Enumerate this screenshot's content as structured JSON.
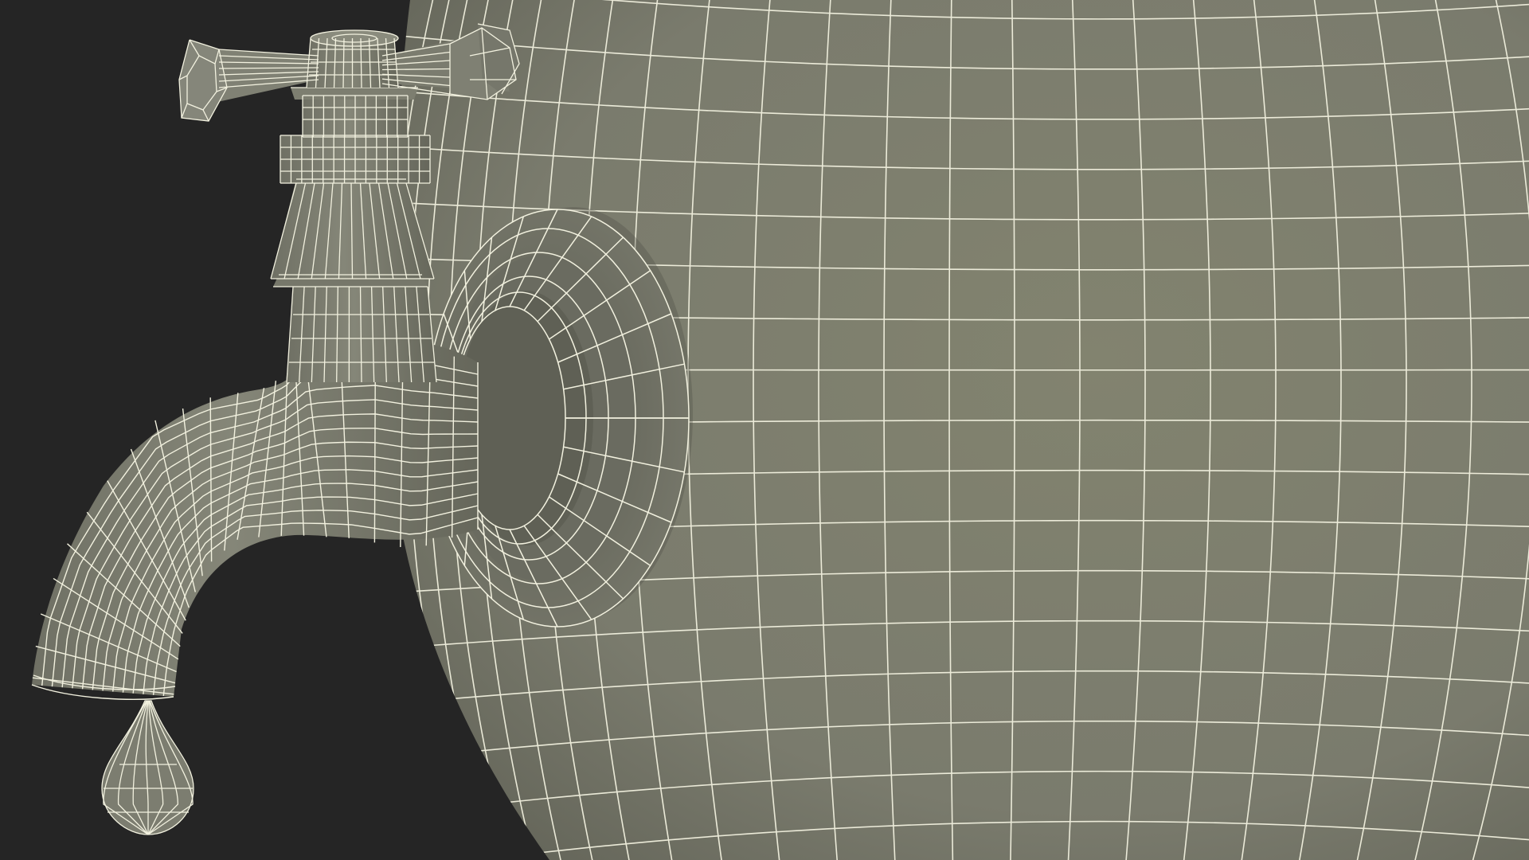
{
  "scene": {
    "subject": "",
    "colors": {
      "background": "#252525",
      "surface": "#7a7b6d",
      "surface_shadow": "#5f6055",
      "surface_light": "#8a8b7c",
      "wire": "#f2f1df"
    }
  }
}
